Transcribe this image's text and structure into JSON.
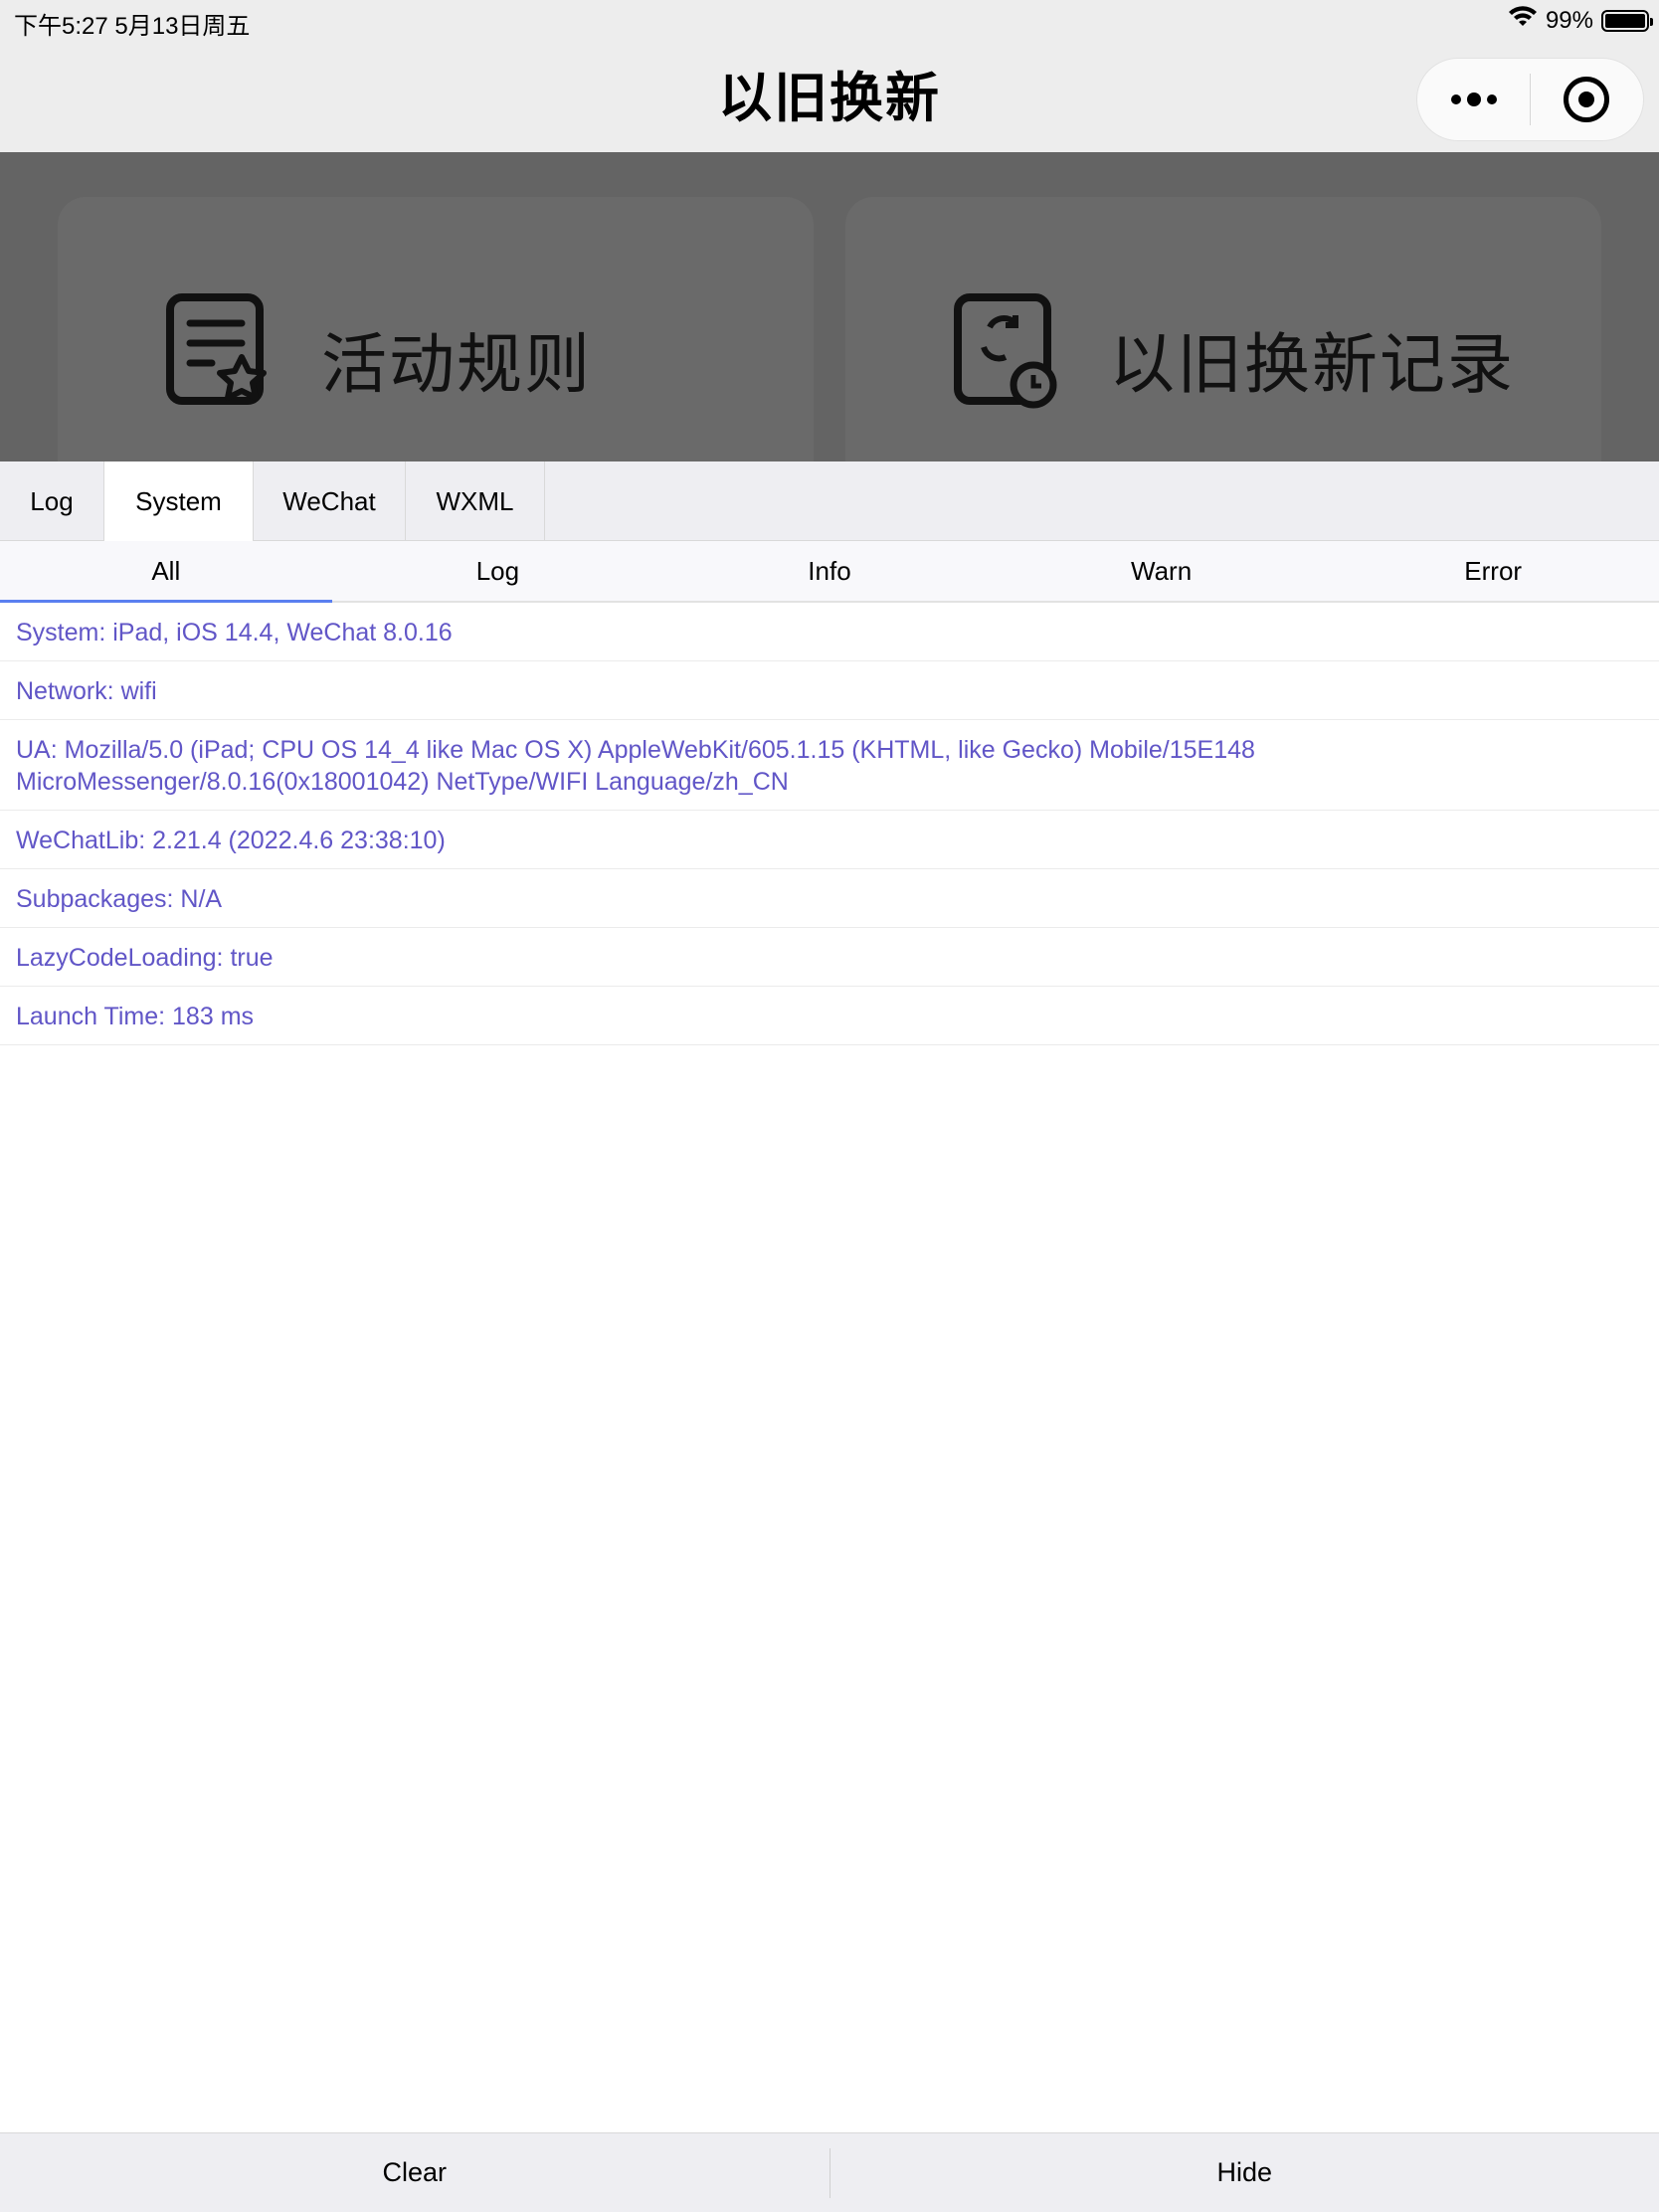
{
  "status_bar": {
    "time_date": "下午5:27   5月13日周五",
    "battery_text": "99%",
    "icons": [
      "wifi-icon",
      "battery-icon"
    ]
  },
  "nav": {
    "title": "以旧换新",
    "capsule_icons": [
      "more-dots-icon",
      "close-miniprogram-icon"
    ]
  },
  "page_cards": [
    {
      "label": "活动规则",
      "icon": "document-star-icon"
    },
    {
      "label": "以旧换新记录",
      "icon": "recycle-clock-icon"
    }
  ],
  "vconsole": {
    "tabs": [
      "Log",
      "System",
      "WeChat",
      "WXML"
    ],
    "active_tab": "System",
    "sub_tabs": [
      "All",
      "Log",
      "Info",
      "Warn",
      "Error"
    ],
    "active_sub_tab": "All",
    "rows": [
      "System: iPad, iOS 14.4, WeChat 8.0.16",
      "Network: wifi",
      "UA: Mozilla/5.0 (iPad; CPU OS 14_4 like Mac OS X) AppleWebKit/605.1.15 (KHTML, like Gecko) Mobile/15E148",
      "MicroMessenger/8.0.16(0x18001042) NetType/WIFI Language/zh_CN",
      "WeChatLib: 2.21.4 (2022.4.6 23:38:10)",
      "Subpackages: N/A",
      "LazyCodeLoading: true",
      "Launch Time: 183 ms"
    ],
    "footer": {
      "clear_label": "Clear",
      "hide_label": "Hide"
    },
    "colors": {
      "log_text": "#6156c7",
      "active_underline": "#5a7ff0"
    }
  }
}
